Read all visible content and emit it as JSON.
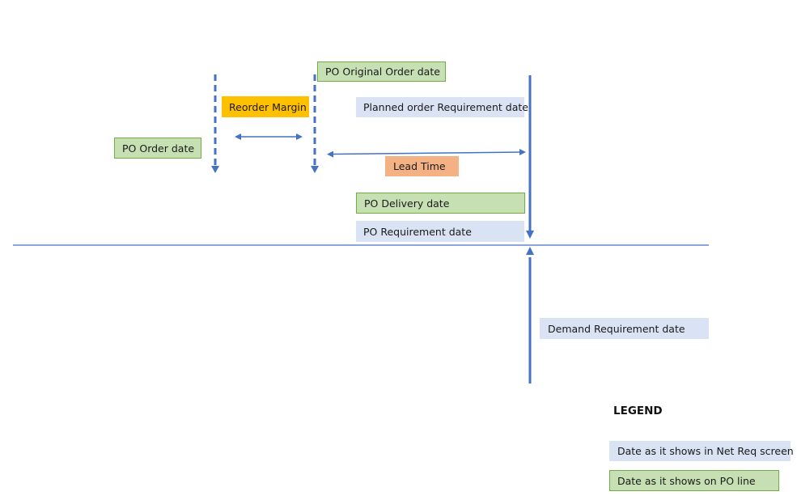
{
  "diagram": {
    "colors": {
      "line": "#4472c4",
      "po_line_fill": "#c6e0b4",
      "po_line_border": "#70ad47",
      "net_req_fill": "#dae3f3",
      "lead_time_fill": "#f4b183",
      "reorder_margin_fill": "#ffc000"
    },
    "labels": {
      "po_original_order_date": "PO Original Order date",
      "reorder_margin": "Reorder Margin",
      "planned_order_requirement_date": "Planned order Requirement date",
      "po_order_date": "PO Order date",
      "lead_time": "Lead Time",
      "po_delivery_date": "PO Delivery date",
      "po_requirement_date": "PO Requirement date",
      "demand_requirement_date": "Demand Requirement date"
    },
    "legend": {
      "title": "LEGEND",
      "items": [
        {
          "label": "Date as it shows in Net Req screen",
          "type": "net-req"
        },
        {
          "label": "Date as it shows on PO line",
          "type": "po-line"
        }
      ]
    }
  }
}
